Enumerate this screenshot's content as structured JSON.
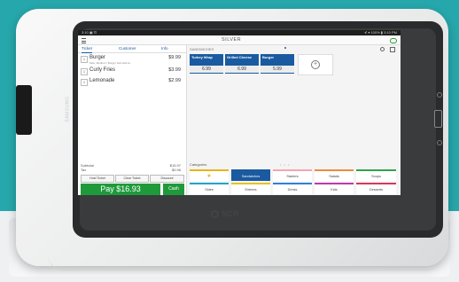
{
  "statusbar": {
    "left": "3:10 ▣ ⊡",
    "right": "⊀ ▾ 100% ▮ 3:10 PM"
  },
  "app": {
    "logo": "SILVER"
  },
  "tabs": {
    "ticket": "Ticket",
    "customer": "Customer",
    "info": "Info"
  },
  "ticket_items": [
    {
      "qty": "1",
      "name": "Burger",
      "sub": "Side, Medium | Burger Sub Add-on",
      "price": "$9.99"
    },
    {
      "qty": "1",
      "name": "Curly Fries",
      "sub": "",
      "price": "$3.99"
    },
    {
      "qty": "1",
      "name": "Lemonade",
      "sub": "",
      "price": "$2.99"
    }
  ],
  "totals": {
    "subtotal_label": "Subtotal",
    "subtotal": "$15.97",
    "tax_label": "Tax",
    "tax": "$0.96"
  },
  "actions": {
    "hold": "Hold Ticket",
    "clear": "Clear Ticket",
    "discount": "Discount"
  },
  "pay": {
    "label": "Pay $16.93",
    "cash": "Cash"
  },
  "right_panel": {
    "header": "SANDWICHES"
  },
  "tiles": [
    {
      "name": "Turkey Wrap",
      "price": "6.99"
    },
    {
      "name": "Grilled Cheese",
      "price": "6.99"
    },
    {
      "name": "Burger",
      "price": "5.99"
    }
  ],
  "categories": {
    "label": "Categories",
    "dots": "• • •",
    "row1": [
      {
        "name": "★",
        "color": "#e8b41c"
      },
      {
        "name": "Sandwiches",
        "color": "#1a5aa0"
      },
      {
        "name": "Starters",
        "color": "#f2a6b4"
      },
      {
        "name": "Salads",
        "color": "#f08a3c"
      },
      {
        "name": "Soups",
        "color": "#2fa34a"
      }
    ],
    "row2": [
      {
        "name": "Sides",
        "color": "#1fa6c8"
      },
      {
        "name": "Entrees",
        "color": "#e8c21c"
      },
      {
        "name": "Drinks",
        "color": "#2f7fd8"
      },
      {
        "name": "Kids",
        "color": "#c038a8"
      },
      {
        "name": "Desserts",
        "color": "#d6385a"
      }
    ]
  },
  "device": {
    "tablet_brand": "SAMSUNG",
    "brand": "NCR"
  }
}
